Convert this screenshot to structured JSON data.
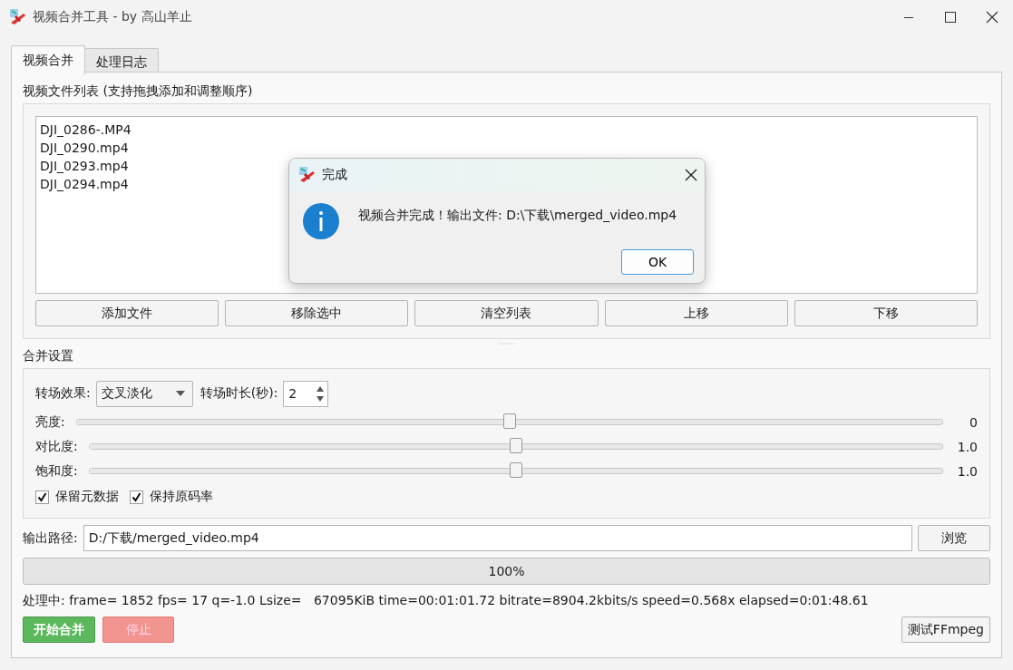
{
  "window": {
    "title": "视频合并工具 - by 高山羊止"
  },
  "tabs": [
    {
      "label": "视频合并",
      "selected": true
    },
    {
      "label": "处理日志",
      "selected": false
    }
  ],
  "file_list": {
    "label": "视频文件列表 (支持拖拽添加和调整顺序)",
    "items": [
      "DJI_0286-.MP4",
      "DJI_0290.mp4",
      "DJI_0293.mp4",
      "DJI_0294.mp4"
    ]
  },
  "list_buttons": [
    "添加文件",
    "移除选中",
    "清空列表",
    "上移",
    "下移"
  ],
  "merge_settings": {
    "label": "合并设置",
    "transition": {
      "label": "转场效果:",
      "value": "交叉淡化"
    },
    "duration": {
      "label": "转场时长(秒):",
      "value": "2"
    },
    "sliders": [
      {
        "label": "亮度:",
        "level": 0.5,
        "reading": "0"
      },
      {
        "label": "对比度:",
        "level": 0.5,
        "reading": "1.0"
      },
      {
        "label": "饱和度:",
        "level": 0.5,
        "reading": "1.0"
      }
    ],
    "checkboxes": [
      {
        "label": "保留元数据",
        "checked": true
      },
      {
        "label": "保持原码率",
        "checked": true
      }
    ]
  },
  "output": {
    "label": "输出路径:",
    "value": "D:/下载/merged_video.mp4",
    "browse": "浏览"
  },
  "progress": {
    "level": 1,
    "text": "100%"
  },
  "status": "处理中: frame= 1852 fps= 17 q=-1.0 Lsize=   67095KiB time=00:01:01.72 bitrate=8904.2kbits/s speed=0.568x elapsed=0:01:48.61",
  "buttons": [
    {
      "label": "开始合并",
      "kind": "start",
      "disabled": false
    },
    {
      "label": "停止",
      "kind": "stop",
      "disabled": true
    },
    {
      "label": "测试FFmpeg",
      "kind": "test",
      "disabled": false
    }
  ],
  "dialog": {
    "title": "完成",
    "message": "视频合并完成！输出文件: D:\\下载\\merged_video.mp4",
    "button": "OK"
  }
}
